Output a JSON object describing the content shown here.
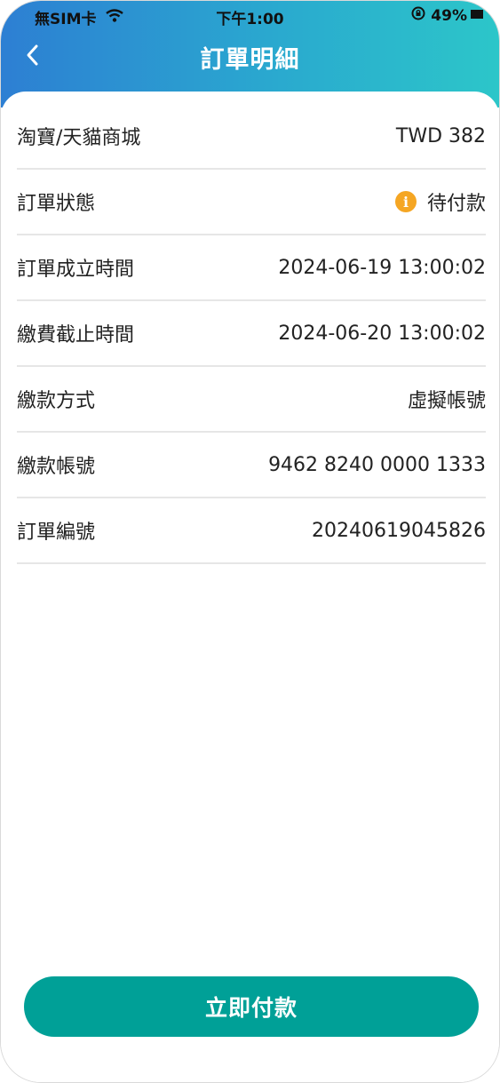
{
  "status_bar": {
    "carrier": "無SIM卡",
    "time": "下午1:00",
    "battery": "49%"
  },
  "header": {
    "title": "訂單明細",
    "back_icon": "chevron-left-icon"
  },
  "details": [
    {
      "label": "淘寶/天貓商城",
      "value": "TWD 382"
    },
    {
      "label": "訂單狀態",
      "value": "待付款",
      "icon": "info-icon",
      "icon_color": "#f5a623"
    },
    {
      "label": "訂單成立時間",
      "value": "2024-06-19 13:00:02"
    },
    {
      "label": "繳費截止時間",
      "value": "2024-06-20 13:00:02"
    },
    {
      "label": "繳款方式",
      "value": "虛擬帳號"
    },
    {
      "label": "繳款帳號",
      "value": "9462 8240 0000 1333"
    },
    {
      "label": "訂單編號",
      "value": "20240619045826"
    }
  ],
  "action": {
    "pay_label": "立即付款"
  },
  "colors": {
    "header_start": "#2d7fd3",
    "header_end": "#2cc6c9",
    "button": "#00a097",
    "status_pending": "#f5a623"
  }
}
